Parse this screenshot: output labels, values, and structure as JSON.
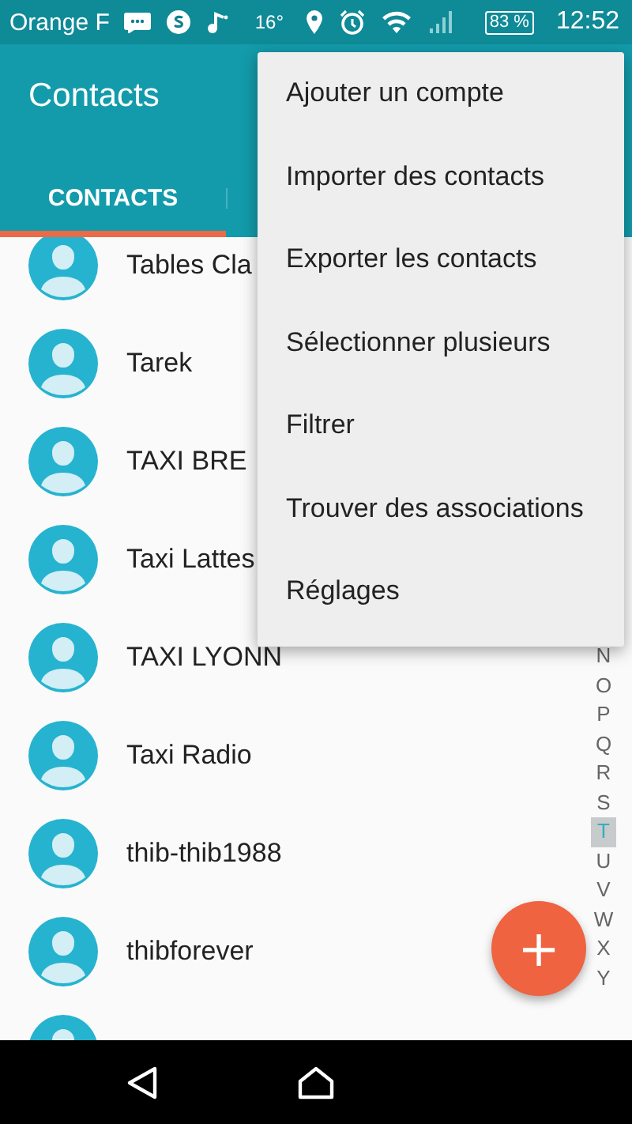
{
  "status_bar": {
    "carrier": "Orange F",
    "temperature": "16°",
    "battery": "83 %",
    "time": "12:52"
  },
  "app_bar": {
    "title": "Contacts",
    "tabs": [
      {
        "label": "CONTACTS",
        "selected": true
      }
    ]
  },
  "contacts": [
    {
      "kind": "named",
      "name": "Tables Cla"
    },
    {
      "kind": "named",
      "name": "Tarek"
    },
    {
      "kind": "named",
      "name": "TAXI BRE"
    },
    {
      "kind": "named",
      "name": "Taxi Lattes"
    },
    {
      "kind": "named",
      "name": "TAXI LYONN"
    },
    {
      "kind": "named",
      "name": "Taxi Radio"
    },
    {
      "kind": "named",
      "name": "thib-thib1988"
    },
    {
      "kind": "named",
      "name": "thibforever"
    },
    {
      "kind": "avatar_only"
    }
  ],
  "index": [
    {
      "letter": "N",
      "selected": false
    },
    {
      "letter": "O",
      "selected": false
    },
    {
      "letter": "P",
      "selected": false
    },
    {
      "letter": "Q",
      "selected": false
    },
    {
      "letter": "R",
      "selected": false
    },
    {
      "letter": "S",
      "selected": false
    },
    {
      "letter": "T",
      "selected": true
    },
    {
      "letter": "U",
      "selected": false
    },
    {
      "letter": "V",
      "selected": false
    },
    {
      "letter": "W",
      "selected": false
    },
    {
      "letter": "X",
      "selected": false
    },
    {
      "letter": "Y",
      "selected": false
    }
  ],
  "menu": {
    "items": [
      "Ajouter un compte",
      "Importer des contacts",
      "Exporter les contacts",
      "Sélectionner plusieurs",
      "Filtrer",
      "Trouver des associations",
      "Réglages"
    ]
  },
  "fab": {
    "label": "+"
  }
}
